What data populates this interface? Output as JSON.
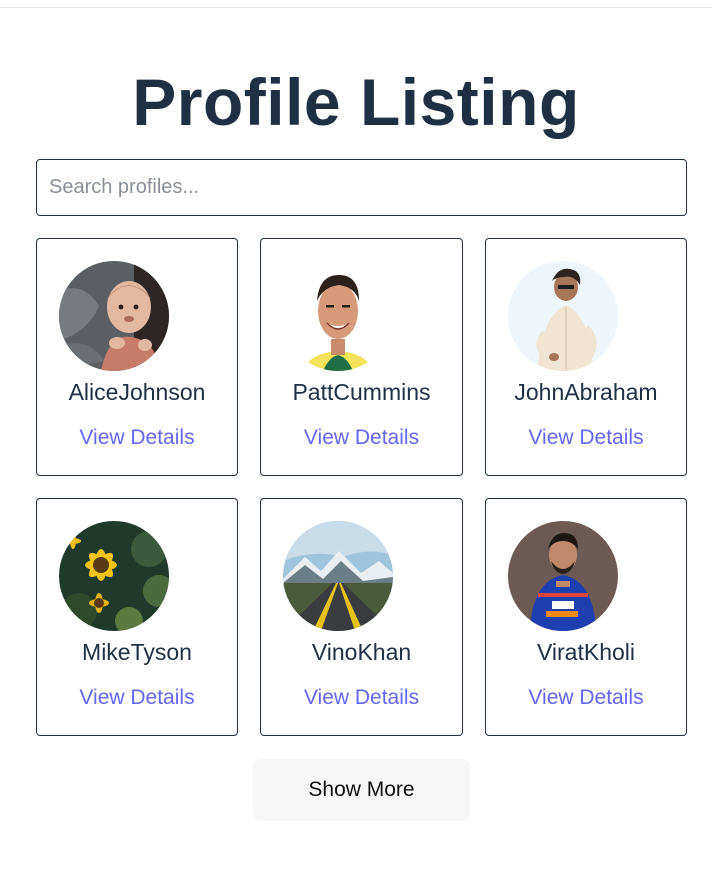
{
  "page": {
    "title": "Profile Listing"
  },
  "search": {
    "placeholder": "Search profiles..."
  },
  "profiles": [
    {
      "name": "AliceJohnson",
      "link": "View Details",
      "avatar": "baby-photo"
    },
    {
      "name": "PattCummins",
      "link": "View Details",
      "avatar": "cricketer-portrait-photo"
    },
    {
      "name": "JohnAbraham",
      "link": "View Details",
      "avatar": "man-white-shirt-photo"
    },
    {
      "name": "MikeTyson",
      "link": "View Details",
      "avatar": "sunflower-photo"
    },
    {
      "name": "VinoKhan",
      "link": "View Details",
      "avatar": "mountain-road-photo"
    },
    {
      "name": "ViratKholi",
      "link": "View Details",
      "avatar": "cricketer-blue-jersey-photo"
    }
  ],
  "actions": {
    "show_more_label": "Show More"
  },
  "colors": {
    "title": "#1f2f44",
    "border": "#1f2f44",
    "link": "#6366f1",
    "button_bg": "#f7f7f7"
  }
}
